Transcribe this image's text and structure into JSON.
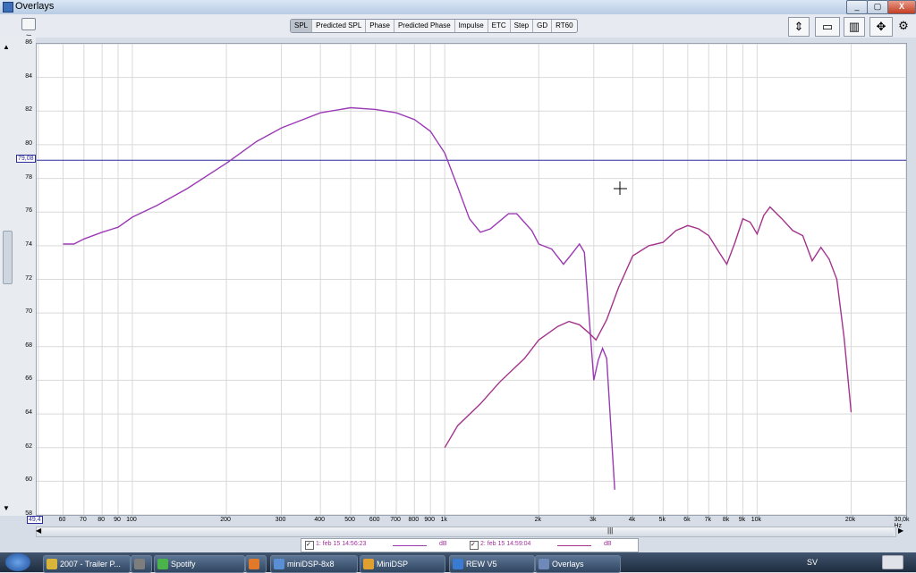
{
  "window": {
    "title": "Overlays"
  },
  "toolbar": {
    "tabs": [
      "SPL",
      "Predicted SPL",
      "Phase",
      "Predicted Phase",
      "Impulse",
      "ETC",
      "Step",
      "GD",
      "RT60"
    ],
    "active_tab": "SPL"
  },
  "chart_data": {
    "type": "line",
    "x_scale": "log",
    "xlim": [
      49.4,
      30000
    ],
    "ylim": [
      58,
      86
    ],
    "ylabel": "dB",
    "xunit": "Hz",
    "y_ticks": [
      "86",
      "84",
      "82",
      "80",
      "78",
      "76",
      "74",
      "72",
      "70",
      "68",
      "66",
      "64",
      "62",
      "60",
      "58"
    ],
    "x_ticks": [
      {
        "v": 60,
        "t": "60"
      },
      {
        "v": 70,
        "t": "70"
      },
      {
        "v": 80,
        "t": "80"
      },
      {
        "v": 90,
        "t": "90"
      },
      {
        "v": 100,
        "t": "100"
      },
      {
        "v": 200,
        "t": "200"
      },
      {
        "v": 300,
        "t": "300"
      },
      {
        "v": 400,
        "t": "400"
      },
      {
        "v": 500,
        "t": "500"
      },
      {
        "v": 600,
        "t": "600"
      },
      {
        "v": 700,
        "t": "700"
      },
      {
        "v": 800,
        "t": "800"
      },
      {
        "v": 900,
        "t": "900"
      },
      {
        "v": 1000,
        "t": "1k"
      },
      {
        "v": 2000,
        "t": "2k"
      },
      {
        "v": 3000,
        "t": "3k"
      },
      {
        "v": 4000,
        "t": "4k"
      },
      {
        "v": 5000,
        "t": "5k"
      },
      {
        "v": 6000,
        "t": "6k"
      },
      {
        "v": 7000,
        "t": "7k"
      },
      {
        "v": 8000,
        "t": "8k"
      },
      {
        "v": 9000,
        "t": "9k"
      },
      {
        "v": 10000,
        "t": "10k"
      },
      {
        "v": 20000,
        "t": "20k"
      },
      {
        "v": 30000,
        "t": "30,0k Hz"
      }
    ],
    "cursor_y": {
      "value": 79.08,
      "label": "79,08"
    },
    "x_min_label": "49,4",
    "series": [
      {
        "name": "1: feb 15 14:56:23",
        "unit": "dB",
        "color": "#9b3ab4",
        "points": [
          [
            60,
            74.1
          ],
          [
            65,
            74.1
          ],
          [
            70,
            74.4
          ],
          [
            80,
            74.8
          ],
          [
            90,
            75.1
          ],
          [
            100,
            75.7
          ],
          [
            120,
            76.4
          ],
          [
            150,
            77.4
          ],
          [
            200,
            78.9
          ],
          [
            250,
            80.2
          ],
          [
            300,
            81.0
          ],
          [
            400,
            81.9
          ],
          [
            500,
            82.2
          ],
          [
            600,
            82.1
          ],
          [
            700,
            81.9
          ],
          [
            800,
            81.5
          ],
          [
            900,
            80.8
          ],
          [
            1000,
            79.5
          ],
          [
            1100,
            77.5
          ],
          [
            1200,
            75.6
          ],
          [
            1300,
            74.8
          ],
          [
            1400,
            75.0
          ],
          [
            1600,
            75.9
          ],
          [
            1700,
            75.9
          ],
          [
            1900,
            74.9
          ],
          [
            2000,
            74.1
          ],
          [
            2200,
            73.8
          ],
          [
            2400,
            72.9
          ],
          [
            2500,
            73.3
          ],
          [
            2700,
            74.1
          ],
          [
            2800,
            73.6
          ],
          [
            3000,
            66.0
          ],
          [
            3100,
            67.2
          ],
          [
            3200,
            67.9
          ],
          [
            3300,
            67.3
          ],
          [
            3500,
            59.5
          ]
        ]
      },
      {
        "name": "2: feb 15 14:59:04",
        "unit": "dB",
        "color": "#a3338c",
        "points": [
          [
            1000,
            62.0
          ],
          [
            1100,
            63.3
          ],
          [
            1300,
            64.6
          ],
          [
            1500,
            65.9
          ],
          [
            1800,
            67.3
          ],
          [
            2000,
            68.4
          ],
          [
            2300,
            69.2
          ],
          [
            2500,
            69.5
          ],
          [
            2700,
            69.3
          ],
          [
            2900,
            68.8
          ],
          [
            3050,
            68.4
          ],
          [
            3300,
            69.6
          ],
          [
            3600,
            71.5
          ],
          [
            4000,
            73.4
          ],
          [
            4500,
            74.0
          ],
          [
            5000,
            74.2
          ],
          [
            5500,
            74.9
          ],
          [
            6000,
            75.2
          ],
          [
            6500,
            75.0
          ],
          [
            7000,
            74.6
          ],
          [
            7500,
            73.7
          ],
          [
            8000,
            72.9
          ],
          [
            8500,
            74.2
          ],
          [
            9000,
            75.6
          ],
          [
            9500,
            75.4
          ],
          [
            10000,
            74.7
          ],
          [
            10500,
            75.8
          ],
          [
            11000,
            76.3
          ],
          [
            12000,
            75.6
          ],
          [
            13000,
            74.9
          ],
          [
            14000,
            74.6
          ],
          [
            15000,
            73.1
          ],
          [
            16000,
            73.9
          ],
          [
            17000,
            73.2
          ],
          [
            18000,
            72.0
          ],
          [
            19000,
            68.5
          ],
          [
            20000,
            64.1
          ]
        ]
      }
    ]
  },
  "legend": {
    "items": [
      {
        "label": "1: feb 15 14:56:23",
        "unit": "dB"
      },
      {
        "label": "2: feb 15 14:59:04",
        "unit": "dB"
      }
    ]
  },
  "taskbar": {
    "tasks": [
      "2007 - Trailer P...",
      "",
      "Spotify",
      "",
      "miniDSP-8x8",
      "MiniDSP",
      "REW V5",
      "Overlays"
    ],
    "lang": "SV"
  }
}
